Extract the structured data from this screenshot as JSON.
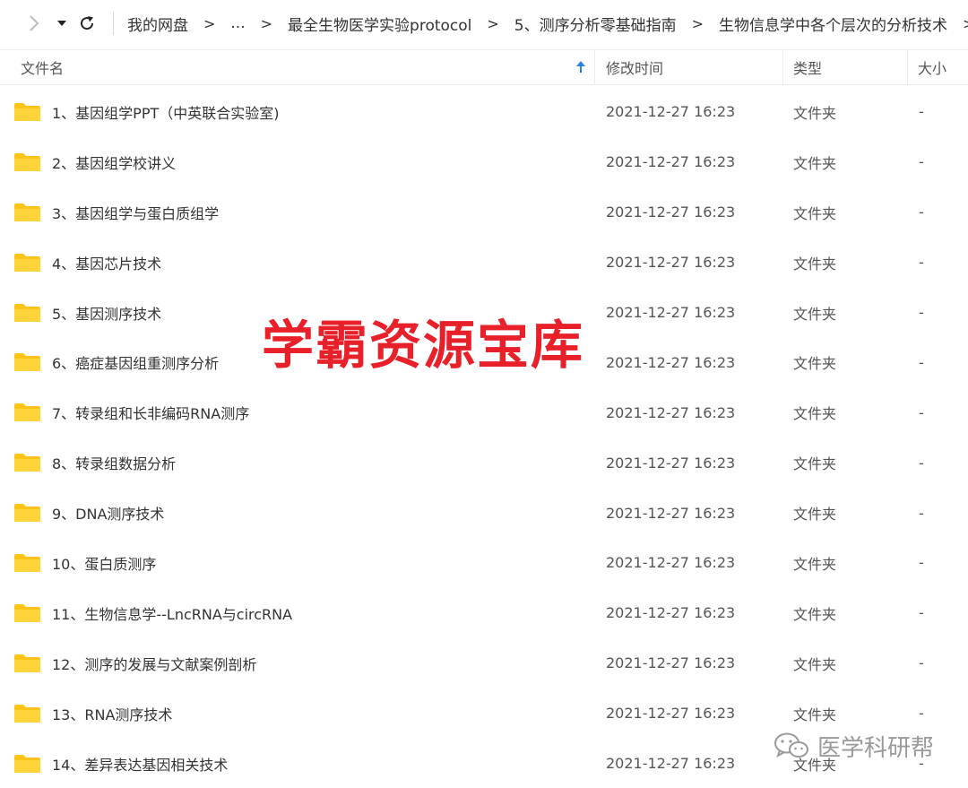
{
  "nav": {
    "forward_icon": "chevron-right-icon",
    "dropdown_icon": "caret-down-icon",
    "refresh_icon": "refresh-icon"
  },
  "breadcrumb": [
    "我的网盘",
    "...",
    "最全生物医学实验protocol",
    "5、测序分析零基础指南",
    "生物信息学中各个层次的分析技术"
  ],
  "breadcrumb_separator": ">",
  "columns": {
    "name": "文件名",
    "modified": "修改时间",
    "type": "类型",
    "size": "大小"
  },
  "sort_icon": "sort-ascending-arrow-icon",
  "accent_color": "#2b7fe0",
  "folder_color": "#fcc419",
  "files": [
    {
      "name": "1、基因组学PPT（中英联合实验室)",
      "modified": "2021-12-27 16:23",
      "type": "文件夹",
      "size": "-"
    },
    {
      "name": "2、基因组学校讲义",
      "modified": "2021-12-27 16:23",
      "type": "文件夹",
      "size": "-"
    },
    {
      "name": "3、基因组学与蛋白质组学",
      "modified": "2021-12-27 16:23",
      "type": "文件夹",
      "size": "-"
    },
    {
      "name": "4、基因芯片技术",
      "modified": "2021-12-27 16:23",
      "type": "文件夹",
      "size": "-"
    },
    {
      "name": "5、基因测序技术",
      "modified": "2021-12-27 16:23",
      "type": "文件夹",
      "size": "-"
    },
    {
      "name": "6、癌症基因组重测序分析",
      "modified": "2021-12-27 16:23",
      "type": "文件夹",
      "size": "-"
    },
    {
      "name": "7、转录组和长非编码RNA测序",
      "modified": "2021-12-27 16:23",
      "type": "文件夹",
      "size": "-"
    },
    {
      "name": "8、转录组数据分析",
      "modified": "2021-12-27 16:23",
      "type": "文件夹",
      "size": "-"
    },
    {
      "name": "9、DNA测序技术",
      "modified": "2021-12-27 16:23",
      "type": "文件夹",
      "size": "-"
    },
    {
      "name": "10、蛋白质测序",
      "modified": "2021-12-27 16:23",
      "type": "文件夹",
      "size": "-"
    },
    {
      "name": "11、生物信息学--LncRNA与circRNA",
      "modified": "2021-12-27 16:23",
      "type": "文件夹",
      "size": "-"
    },
    {
      "name": "12、测序的发展与文献案例剖析",
      "modified": "2021-12-27 16:23",
      "type": "文件夹",
      "size": "-"
    },
    {
      "name": "13、RNA测序技术",
      "modified": "2021-12-27 16:23",
      "type": "文件夹",
      "size": "-"
    },
    {
      "name": "14、差异表达基因相关技术",
      "modified": "2021-12-27 16:23",
      "type": "文件夹",
      "size": "-"
    }
  ],
  "overlay": {
    "watermark": "学霸资源宝库",
    "watermark_color": "#e8202a",
    "brand": "医学科研帮",
    "brand_icon": "wechat-icon"
  }
}
